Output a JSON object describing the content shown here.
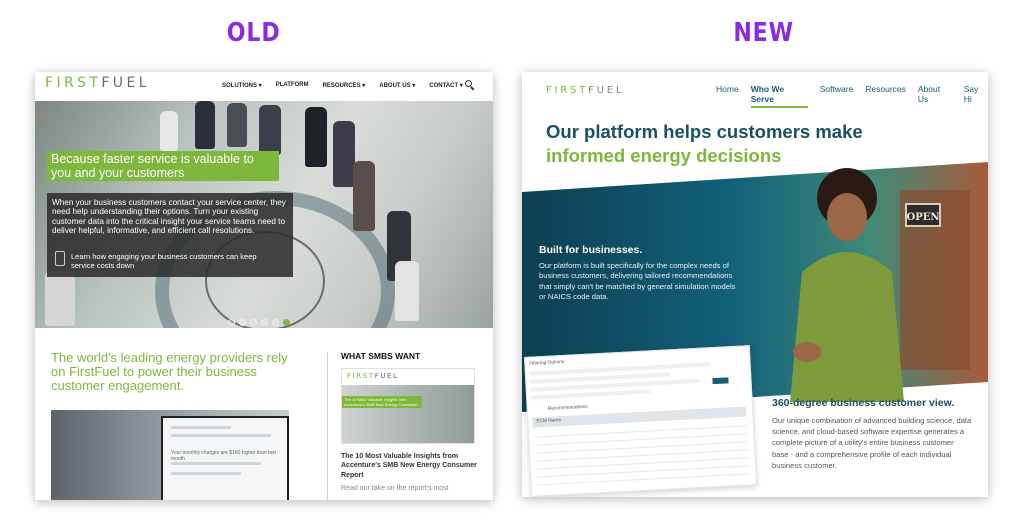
{
  "headings": {
    "old": "OLD",
    "new": "NEW"
  },
  "old": {
    "logo": {
      "first": "FIRST",
      "fuel": "FUEL"
    },
    "nav": [
      "SOLUTIONS ▾",
      "PLATFORM",
      "RESOURCES ▾",
      "ABOUT US ▾",
      "CONTACT ▾"
    ],
    "hero": {
      "tagline": "Because faster service is valuable to you and your customers",
      "description": "When your business customers contact your service center, they need help understanding their options. Turn your existing customer data into the critical insight your service teams need to deliver helpful, informative, and efficient call resolutions.",
      "link": "Learn how engaging your business customers can keep service costs down",
      "slides": 6,
      "active_slide": 6
    },
    "lead": "The world's leading energy providers rely on FirstFuel to power their business customer engagement.",
    "screen_text": "Your monthly charges are $160 higher than last month",
    "sidebar": {
      "title": "WHAT SMBS WANT",
      "card_logo": {
        "first": "FIRST",
        "fuel": "FUEL"
      },
      "card_banner": "The 10 Most Valuable Insights from Accenture's SMB New Energy Consumer",
      "card_title": "The 10 Most Valuable Insights from Accenture's SMB New Energy Consumer Report",
      "more": "Read our take on the report's most"
    },
    "colors": {
      "green": "#7db73b",
      "dark": "#2d2d2d"
    }
  },
  "new": {
    "logo": {
      "first": "FIRST",
      "fuel": "FUEL"
    },
    "nav": [
      {
        "label": "Home",
        "active": false
      },
      {
        "label": "Who We Serve",
        "active": true
      },
      {
        "label": "Software",
        "active": false
      },
      {
        "label": "Resources",
        "active": false
      },
      {
        "label": "About Us",
        "active": false
      },
      {
        "label": "Say Hi",
        "active": false
      }
    ],
    "title_line1": "Our platform helps customers make",
    "title_line2": "informed energy decisions",
    "hero": {
      "subtitle": "Built for businesses.",
      "body": "Our platform is built specifically for the complex needs of business customers, delivering tailored recommendations that simply can't be matched by general simulation models or NAICS code data.",
      "sign": "OPEN"
    },
    "screenshot": {
      "header": "Filtering Options",
      "tab": "Recommendations",
      "column": "ECM Name"
    },
    "section2": {
      "subtitle": "360-degree business customer view.",
      "body": "Our unique combination of advanced building science, data science, and cloud-based software expertise generates a complete picture of a utility's entire business customer base - and a comprehensive profile of each individual business customer."
    },
    "colors": {
      "navy": "#1b4f63",
      "green": "#7db73b",
      "teal": "#0f5f73"
    }
  }
}
